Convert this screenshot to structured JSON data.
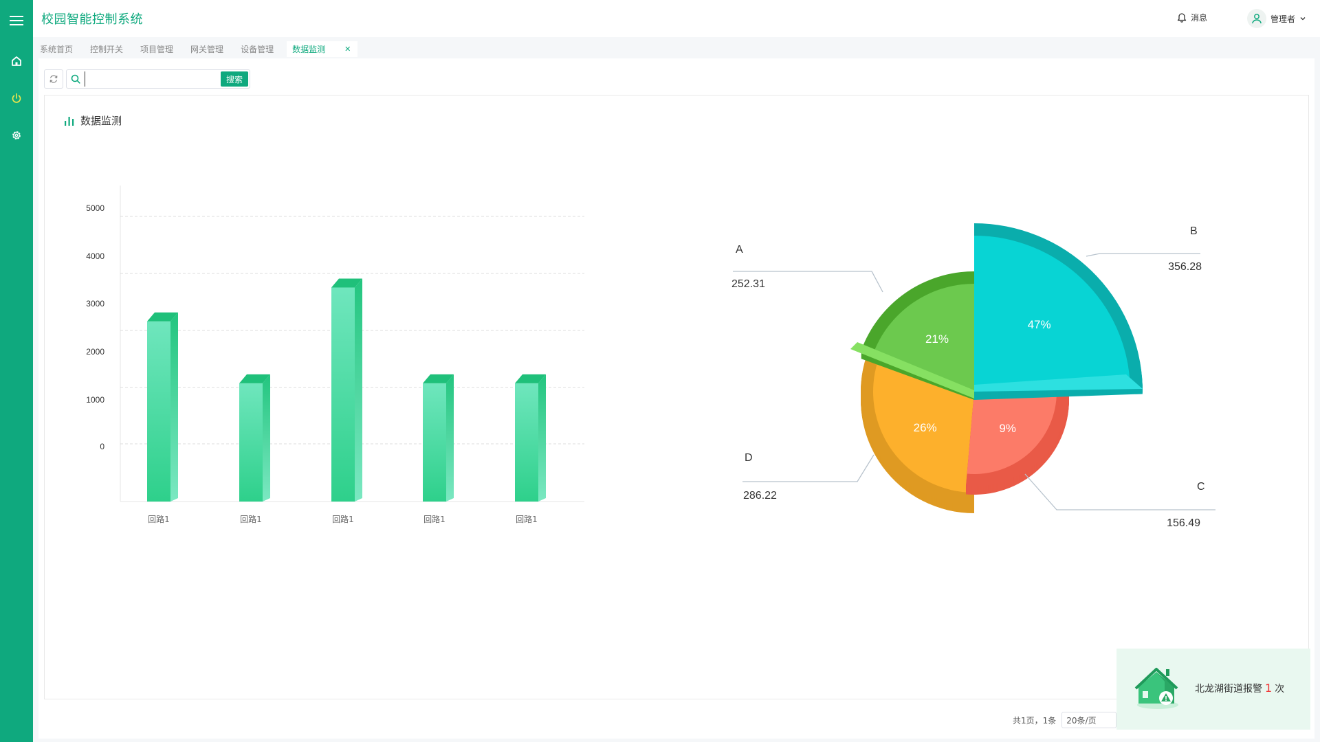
{
  "app": {
    "title": "校园智能控制系统"
  },
  "header": {
    "messages_label": "消息",
    "user_label": "管理者"
  },
  "tabs": [
    {
      "label": "系统首页"
    },
    {
      "label": "控制开关"
    },
    {
      "label": "项目管理"
    },
    {
      "label": "网关管理"
    },
    {
      "label": "设备管理"
    },
    {
      "label": "数据监测",
      "active": true
    }
  ],
  "toolbar": {
    "search_placeholder": "",
    "search_label": "搜索"
  },
  "panel": {
    "title": "数据监测"
  },
  "pagination": {
    "summary": "共1页，1条",
    "page_size": "20条/页"
  },
  "alert": {
    "text": "北龙湖街道报警",
    "count": "1",
    "unit": "次"
  },
  "colors": {
    "accent": "#0fa97e",
    "alert_count": "#f03c3c"
  },
  "chart_data": [
    {
      "type": "bar",
      "categories": [
        "回路1",
        "回路1",
        "回路1",
        "回路1",
        "回路1"
      ],
      "values": [
        3200,
        2100,
        3800,
        2100,
        2100
      ],
      "yticks": [
        "5000",
        "4000",
        "3000",
        "2000",
        "1000",
        "0"
      ],
      "grid": true,
      "color": "#2ed08b"
    },
    {
      "type": "pie",
      "slices": [
        {
          "name": "A",
          "value": 252.31,
          "percent": "21%",
          "color": "#6cc94e"
        },
        {
          "name": "B",
          "value": 356.28,
          "percent": "47%",
          "color": "#08d4d4"
        },
        {
          "name": "C",
          "value": 156.49,
          "percent": "9%",
          "color": "#fc7b68"
        },
        {
          "name": "D",
          "value": 286.22,
          "percent": "26%",
          "color": "#fdb02c"
        }
      ]
    }
  ]
}
